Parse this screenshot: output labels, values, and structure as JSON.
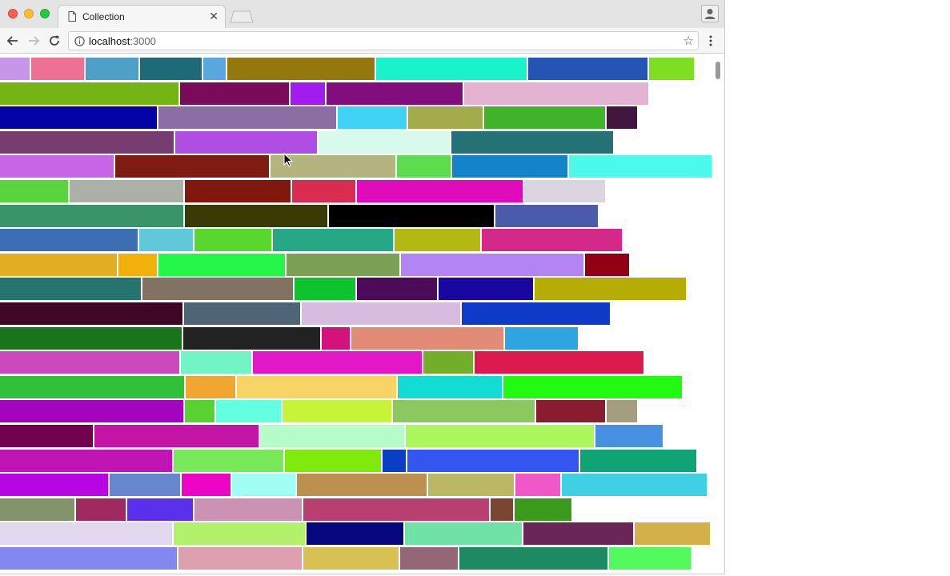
{
  "browser": {
    "tab_title": "Collection",
    "url_host": "localhost",
    "url_port": ":3000"
  },
  "icons": [
    "document-icon",
    "close-icon",
    "new-tab-icon",
    "profile-icon",
    "back-icon",
    "forward-icon",
    "reload-icon",
    "info-icon",
    "star-icon",
    "menu-icon",
    "cursor-icon"
  ],
  "rows": [
    [
      "#c896e8",
      "#ee7094",
      "#4fa0c8",
      "#1e6a78",
      "#5aa6de",
      "#94780e",
      "#1af2cc",
      "#2454b4",
      "#7ede22"
    ],
    [
      "#74b414",
      "#7a0a5a",
      "#a21cf0",
      "#820e7e",
      "#e4b2d2"
    ],
    [
      "#0404a6",
      "#8a6ea4",
      "#40d2f4",
      "#a2ac4a",
      "#40b42a",
      "#42163e"
    ],
    [
      "#763e70",
      "#b04ee4",
      "#d8faec",
      "#247276"
    ],
    [
      "#c666e4",
      "#7e1c14",
      "#b4b480",
      "#5cdc4e",
      "#1484c8",
      "#4cfaea"
    ],
    [
      "#5ad43c",
      "#acb0a6",
      "#80180e",
      "#da2c50",
      "#e00cbc",
      "#dcd4de"
    ],
    [
      "#3a946a",
      "#3a3a04",
      "#000000",
      "#4c5aaa"
    ],
    [
      "#3c6eb4",
      "#60c8d8",
      "#58d82e",
      "#26a886",
      "#b4b812",
      "#d4288a"
    ],
    [
      "#e2ae24",
      "#f2b00c",
      "#24f64a",
      "#7ca056",
      "#b284f4",
      "#920016"
    ],
    [
      "#257470",
      "#827262",
      "#0ec42e",
      "#4e0a5a",
      "#1a06a0",
      "#b6ac06"
    ],
    [
      "#400626",
      "#506478",
      "#d8bce0",
      "#0e3ac8"
    ],
    [
      "#1a741a",
      "#222222",
      "#d4127c",
      "#e28c78",
      "#2ea4e0"
    ],
    [
      "#cc48bc",
      "#72f4c4",
      "#e218c8",
      "#72ae2a",
      "#dc1a50"
    ],
    [
      "#30c03a",
      "#f0a630",
      "#f8d466",
      "#12dcd4",
      "#22fa12"
    ],
    [
      "#a404c0",
      "#58d230",
      "#64fee0",
      "#c6f436",
      "#8cc860",
      "#8a1c30",
      "#a49e7e"
    ],
    [
      "#720250",
      "#c414a6",
      "#b6fcc8",
      "#acf65e",
      "#4890e0"
    ],
    [
      "#c014b4",
      "#78ea5a",
      "#7eea0e",
      "#0a3ec4",
      "#3456f0",
      "#10a474"
    ],
    [
      "#b606e4",
      "#6686ce",
      "#ec06c4",
      "#a0fef4",
      "#bc904e",
      "#bab864",
      "#f058c8",
      "#40d0e4"
    ],
    [
      "#84946a",
      "#a02a60",
      "#5a30ec",
      "#cc92b4",
      "#b84070",
      "#7a4632",
      "#3a9a1c"
    ],
    [
      "#e2d8ee",
      "#b2f26a",
      "#06067e",
      "#70e2a6",
      "#6a2656",
      "#d4b04a"
    ],
    [
      "#8288f0",
      "#dea0b0",
      "#d8c054",
      "#946676",
      "#1e8a64",
      "#52fa5e"
    ]
  ]
}
